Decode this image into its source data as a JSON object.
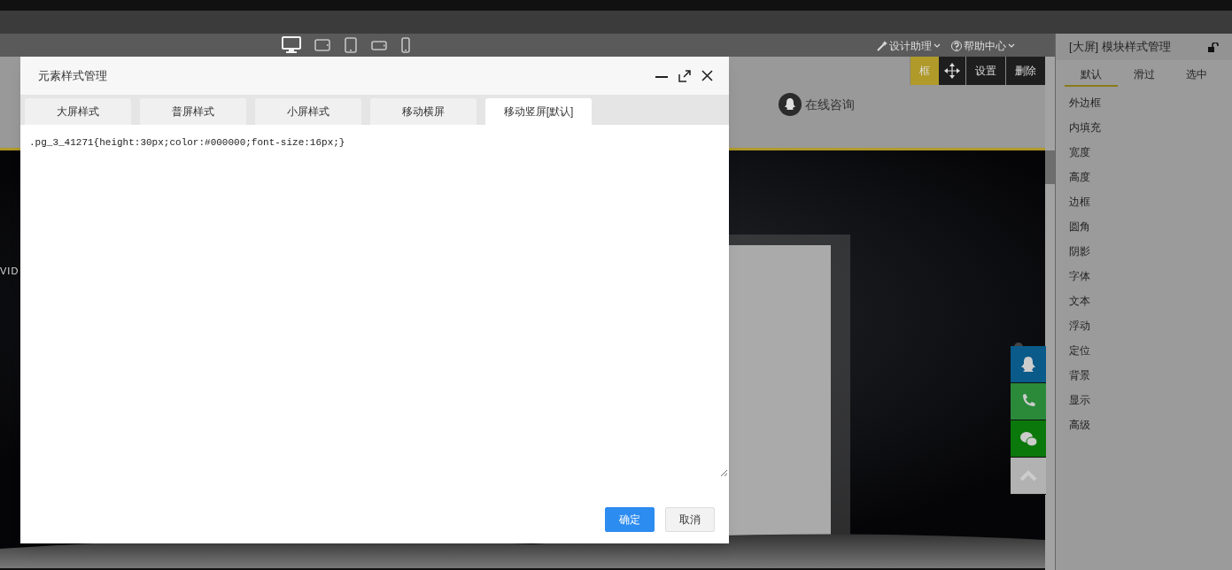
{
  "toolbar": {
    "devices": [
      {
        "kind": "desktop",
        "selected": true
      },
      {
        "kind": "tablet-landscape",
        "selected": false
      },
      {
        "kind": "tablet-portrait",
        "selected": false
      },
      {
        "kind": "phone-landscape",
        "selected": false
      },
      {
        "kind": "phone-portrait",
        "selected": false
      }
    ],
    "menus": [
      {
        "kind": "wand",
        "label": "设计助理"
      },
      {
        "kind": "help",
        "label": "帮助中心"
      }
    ]
  },
  "canvas": {
    "module_actions": [
      {
        "kind": "text",
        "label": "框",
        "selected": true
      },
      {
        "kind": "move",
        "selected": false
      },
      {
        "kind": "text",
        "label": "设置",
        "selected": false
      },
      {
        "kind": "text",
        "label": "删除",
        "selected": false
      }
    ],
    "consult": "在线咨询",
    "banner_text": "VID",
    "float_buttons": [
      {
        "kind": "qq",
        "color": "#0a5a8a"
      },
      {
        "kind": "phone",
        "color": "#2a8a3a"
      },
      {
        "kind": "wechat",
        "color": "#0b780b"
      },
      {
        "kind": "top",
        "color": "#b2b2b2"
      }
    ]
  },
  "dialog": {
    "title": "元素样式管理",
    "tabs": [
      {
        "label": "大屏样式",
        "selected": false
      },
      {
        "label": "普屏样式",
        "selected": false
      },
      {
        "label": "小屏样式",
        "selected": false
      },
      {
        "label": "移动横屏",
        "selected": false
      },
      {
        "label": "移动竖屏[默认]",
        "selected": true
      }
    ],
    "code": ".pg_3_41271{height:30px;color:#000000;font-size:16px;}",
    "buttons": [
      {
        "label": "确定",
        "kind": "primary"
      },
      {
        "label": "取消",
        "kind": "default"
      }
    ]
  },
  "right_panel": {
    "title": "[大屏] 模块样式管理",
    "tabs": [
      {
        "label": "默认",
        "selected": true
      },
      {
        "label": "滑过",
        "selected": false
      },
      {
        "label": "选中",
        "selected": false
      }
    ],
    "items": [
      "外边框",
      "内填充",
      "宽度",
      "高度",
      "边框",
      "圆角",
      "阴影",
      "字体",
      "文本",
      "浮动",
      "定位",
      "背景",
      "显示",
      "高级"
    ]
  }
}
